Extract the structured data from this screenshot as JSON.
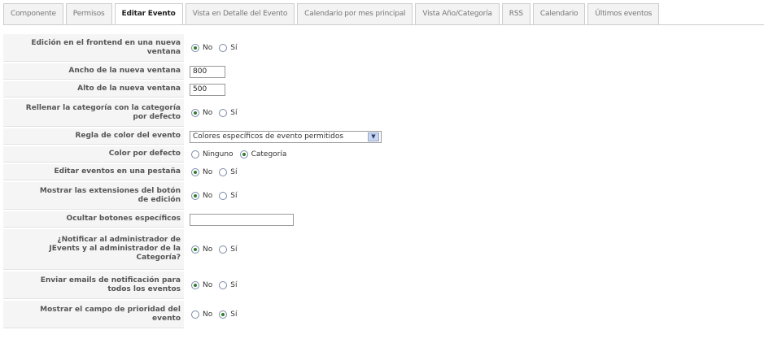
{
  "tabs": [
    {
      "label": "Componente"
    },
    {
      "label": "Permisos"
    },
    {
      "label": "Editar Evento",
      "active": true
    },
    {
      "label": "Vista en Detalle del Evento"
    },
    {
      "label": "Calendario por mes principal"
    },
    {
      "label": "Vista Año/Categoría"
    },
    {
      "label": "RSS"
    },
    {
      "label": "Calendario"
    },
    {
      "label": "Últimos eventos"
    }
  ],
  "settings": {
    "frontend_new_window": {
      "label_1": "Edición en el frontend en una nueva",
      "label_2": "ventana",
      "opt_no": "No",
      "opt_si": "Sí",
      "selected": "No"
    },
    "window_width": {
      "label": "Ancho de la nueva ventana",
      "value": "800"
    },
    "window_height": {
      "label": "Alto de la nueva ventana",
      "value": "500"
    },
    "fill_default_category": {
      "label_1": "Rellenar la categoría con la categoría",
      "label_2": "por defecto",
      "opt_no": "No",
      "opt_si": "Sí",
      "selected": "No"
    },
    "color_rule": {
      "label": "Regla de color del evento",
      "value": "Colores específicos de evento permitidos"
    },
    "default_color": {
      "label": "Color por defecto",
      "opt_none": "Ninguno",
      "opt_category": "Categoría",
      "selected": "Categoría"
    },
    "edit_in_tab": {
      "label": "Editar eventos en una pestaña",
      "opt_no": "No",
      "opt_si": "Sí",
      "selected": "No"
    },
    "show_button_extensions": {
      "label_1": "Mostrar las extensiones del botón",
      "label_2": "de edición",
      "opt_no": "No",
      "opt_si": "Sí",
      "selected": "No"
    },
    "hide_specific_buttons": {
      "label": "Ocultar botones específicos",
      "value": ""
    },
    "notify_admin": {
      "label_1": "¿Notificar al administrador de",
      "label_2": "JEvents y al administrador de la",
      "label_3": "Categoría?",
      "opt_no": "No",
      "opt_si": "Sí",
      "selected": "No"
    },
    "send_notification_emails": {
      "label_1": "Enviar emails de notificación para",
      "label_2": "todos los eventos",
      "opt_no": "No",
      "opt_si": "Sí",
      "selected": "No"
    },
    "show_priority_field": {
      "label_1": "Mostrar el campo de prioridad del",
      "label_2": "evento",
      "opt_no": "No",
      "opt_si": "Sí",
      "selected": "Sí"
    }
  },
  "colors": {
    "tab_bg": "#f3f3f3",
    "label_bg": "#f5f5f5",
    "radio_on": "#2f7d2f"
  }
}
